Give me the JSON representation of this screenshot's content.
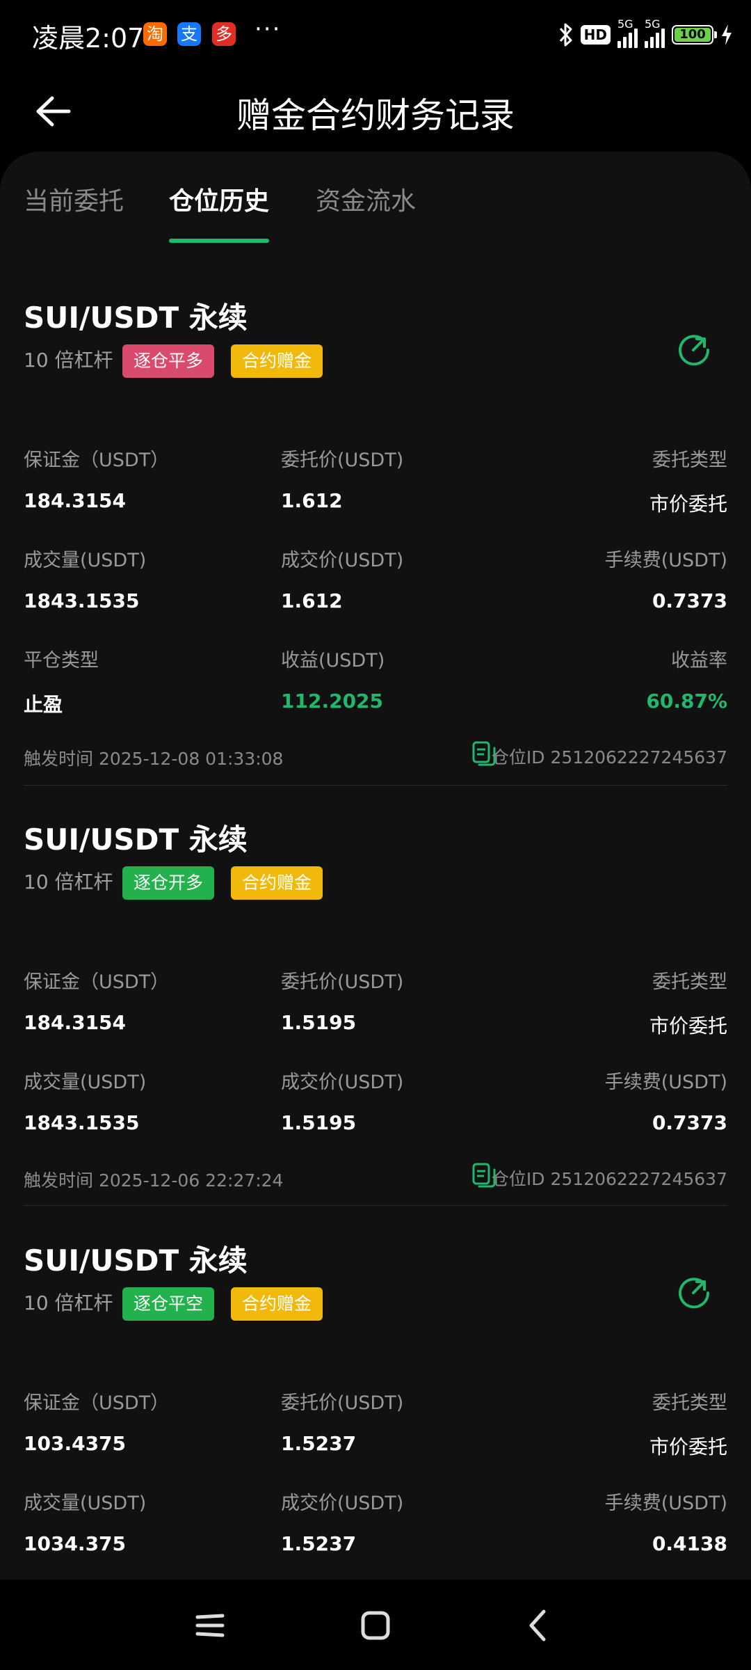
{
  "status_bar": {
    "time": "凌晨2:07",
    "apps": [
      "淘",
      "支",
      "多"
    ],
    "more": "···",
    "hd": "HD",
    "network_1": "5G",
    "network_2": "5G",
    "battery": "100"
  },
  "header": {
    "title": "赠金合约财务记录"
  },
  "tabs": [
    {
      "label": "当前委托",
      "active": false
    },
    {
      "label": "仓位历史",
      "active": true
    },
    {
      "label": "资金流水",
      "active": false
    }
  ],
  "colors": {
    "accent_green": "#1fb86c",
    "badge_red": "#d94a6c",
    "badge_green": "#22b14c",
    "badge_yellow": "#f0b90b"
  },
  "records": [
    {
      "title": "SUI/USDT 永续",
      "leverage": "10 倍杠杆",
      "position_badge": "逐仓平多",
      "bonus_badge": "合约赠金",
      "labels": {
        "margin": "保证金（USDT）",
        "order_price": "委托价(USDT)",
        "order_type": "委托类型",
        "volume": "成交量(USDT)",
        "fill_price": "成交价(USDT)",
        "fee": "手续费(USDT)",
        "close_type": "平仓类型",
        "pnl": "收益(USDT)",
        "pnl_rate": "收益率"
      },
      "values": {
        "margin": "184.3154",
        "order_price": "1.612",
        "order_type": "市价委托",
        "volume": "1843.1535",
        "fill_price": "1.612",
        "fee": "0.7373",
        "close_type": "止盈",
        "pnl": "112.2025",
        "pnl_rate": "60.87%"
      },
      "trigger_time": "触发时间 2025-12-08 01:33:08",
      "position_id": "仓位ID 2512062227245637"
    },
    {
      "title": "SUI/USDT 永续",
      "leverage": "10 倍杠杆",
      "position_badge": "逐仓开多",
      "bonus_badge": "合约赠金",
      "labels": {
        "margin": "保证金（USDT）",
        "order_price": "委托价(USDT)",
        "order_type": "委托类型",
        "volume": "成交量(USDT)",
        "fill_price": "成交价(USDT)",
        "fee": "手续费(USDT)"
      },
      "values": {
        "margin": "184.3154",
        "order_price": "1.5195",
        "order_type": "市价委托",
        "volume": "1843.1535",
        "fill_price": "1.5195",
        "fee": "0.7373"
      },
      "trigger_time": "触发时间 2025-12-06 22:27:24",
      "position_id": "仓位ID 2512062227245637"
    },
    {
      "title": "SUI/USDT 永续",
      "leverage": "10 倍杠杆",
      "position_badge": "逐仓平空",
      "bonus_badge": "合约赠金",
      "labels": {
        "margin": "保证金（USDT）",
        "order_price": "委托价(USDT)",
        "order_type": "委托类型",
        "volume": "成交量(USDT)",
        "fill_price": "成交价(USDT)",
        "fee": "手续费(USDT)"
      },
      "values": {
        "margin": "103.4375",
        "order_price": "1.5237",
        "order_type": "市价委托",
        "volume": "1034.375",
        "fill_price": "1.5237",
        "fee": "0.4138"
      }
    }
  ],
  "icons": {
    "back": "back-arrow-icon",
    "refresh": "refresh-icon",
    "document": "document-icon",
    "nav_menu": "menu-icon",
    "nav_home": "home-icon",
    "nav_back": "back-icon"
  }
}
